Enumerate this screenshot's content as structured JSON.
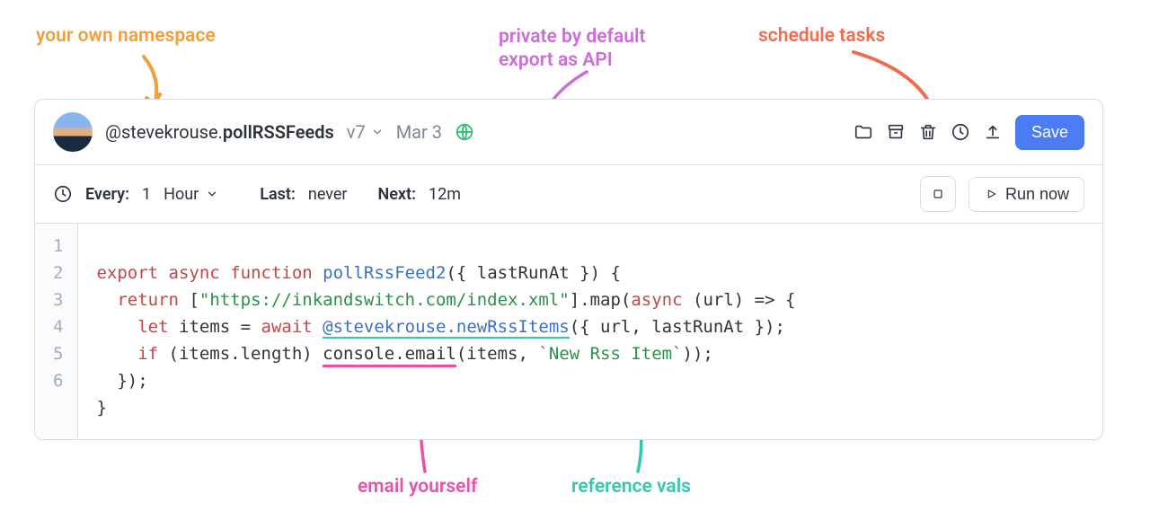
{
  "annotations": {
    "namespace": "your own namespace",
    "private": "private by default\nexport as API",
    "schedule": "schedule tasks",
    "email": "email yourself",
    "reference": "reference vals"
  },
  "header": {
    "namespace_prefix": "@stevekrouse.",
    "namespace_name": "pollRSSFeeds",
    "version": "v7",
    "date": "Mar 3",
    "save": "Save"
  },
  "schedule": {
    "every_label": "Every:",
    "every_value": "1",
    "unit": "Hour",
    "last_label": "Last:",
    "last_value": "never",
    "next_label": "Next:",
    "next_value": "12m",
    "run_now": "Run now"
  },
  "code": {
    "l1": {
      "a": "export",
      "b": "async",
      "c": "function",
      "d": "pollRssFeed2",
      "e": "({ lastRunAt }) {"
    },
    "l2": {
      "a": "return",
      "b": "[",
      "c": "\"https://inkandswitch.com/index.xml\"",
      "d": "].map(",
      "e": "async",
      "f": "(url) => {"
    },
    "l3": {
      "a": "let",
      "b": "items = ",
      "c": "await",
      "d": "@stevekrouse.newRssItems",
      "e": "({ url, lastRunAt });"
    },
    "l4": {
      "a": "if",
      "b": " (items.length) ",
      "c": "console.email",
      "d": "(items, ",
      "e": "`New Rss Item`",
      "f": "));"
    },
    "l5": "  });",
    "l6": "}"
  }
}
